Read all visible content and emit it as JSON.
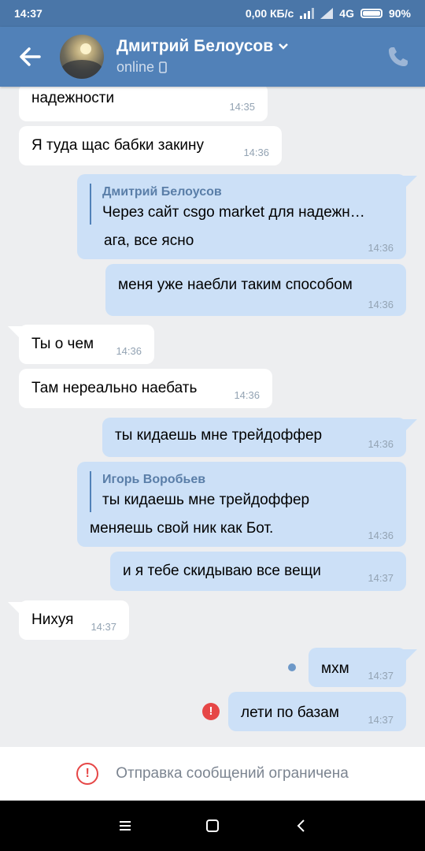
{
  "statusbar": {
    "time": "14:37",
    "network": "0,00 КБ/с",
    "signal": "4G",
    "battery": "90%"
  },
  "header": {
    "name": "Дмитрий Белоусов",
    "status": "online"
  },
  "messages": [
    {
      "dir": "in",
      "text": "надежности",
      "time": "14:35"
    },
    {
      "dir": "in",
      "text": "Я туда щас бабки закину",
      "time": "14:36"
    },
    {
      "dir": "out",
      "quote_name": "Дмитрий Белоусов",
      "quote_text": "Через сайт csgo market для надежн…",
      "text": "ага, все ясно",
      "time": "14:36"
    },
    {
      "dir": "out",
      "text": "меня уже наебли таким способом",
      "time": "14:36"
    },
    {
      "dir": "in",
      "text": "Ты о чем",
      "time": "14:36"
    },
    {
      "dir": "in",
      "text": "Там нереально наебать",
      "time": "14:36"
    },
    {
      "dir": "out",
      "text": "ты кидаешь мне трейдоффер",
      "time": "14:36"
    },
    {
      "dir": "out",
      "quote_name": "Игорь Воробьев",
      "quote_text": "ты кидаешь мне трейдоффер",
      "text": "меняешь свой ник как Бот.",
      "time": "14:36"
    },
    {
      "dir": "out",
      "text": "и я тебе скидываю все вещи",
      "time": "14:37"
    },
    {
      "dir": "in",
      "text": "Нихуя",
      "time": "14:37"
    },
    {
      "dir": "out",
      "text": "мхм",
      "time": "14:37",
      "state": "unread"
    },
    {
      "dir": "out",
      "text": "лети по базам",
      "time": "14:37",
      "state": "failed"
    }
  ],
  "notice": {
    "text": "Отправка сообщений ограничена",
    "icon": "!"
  },
  "colors": {
    "header": "#5181b8",
    "statusbar": "#4a76a8",
    "outgoing_bubble": "#cce0f7",
    "incoming_bubble": "#ffffff",
    "chat_bg": "#edeef0",
    "error": "#e64646"
  },
  "icons": [
    "back-arrow-icon",
    "chevron-down-icon",
    "mobile-icon",
    "phone-icon",
    "unread-dot-icon",
    "error-icon",
    "menu-icon",
    "home-icon",
    "back-nav-icon"
  ]
}
